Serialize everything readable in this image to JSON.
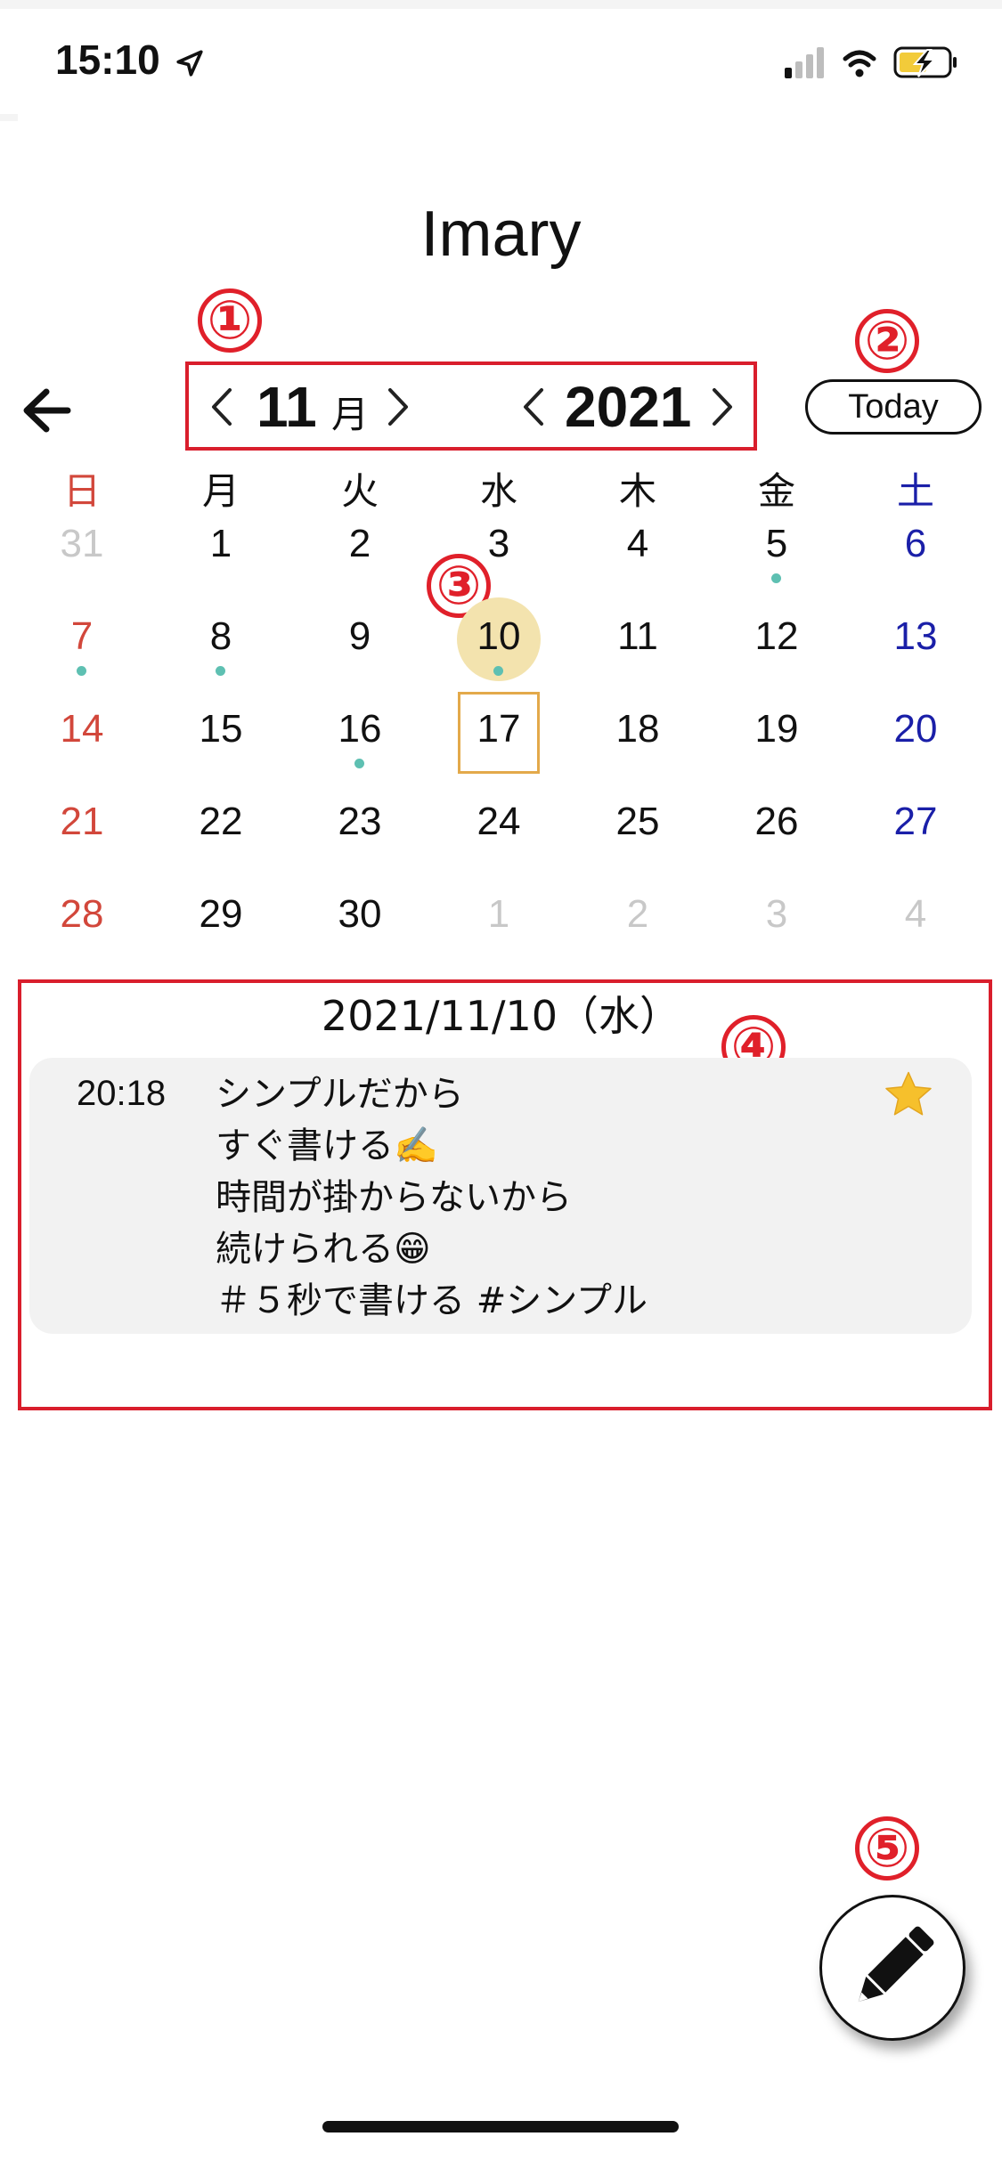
{
  "status_bar": {
    "time": "15:10"
  },
  "app": {
    "title": "Imary"
  },
  "annotations": [
    "①",
    "②",
    "③",
    "④",
    "⑤"
  ],
  "header": {
    "month": "11",
    "month_unit": "月",
    "year": "2021",
    "today_label": "Today"
  },
  "calendar": {
    "weekdays": [
      "日",
      "月",
      "火",
      "水",
      "木",
      "金",
      "土"
    ],
    "weeks": [
      [
        "31",
        "1",
        "2",
        "3",
        "4",
        "5",
        "6"
      ],
      [
        "7",
        "8",
        "9",
        "10",
        "11",
        "12",
        "13"
      ],
      [
        "14",
        "15",
        "16",
        "17",
        "18",
        "19",
        "20"
      ],
      [
        "21",
        "22",
        "23",
        "24",
        "25",
        "26",
        "27"
      ],
      [
        "28",
        "29",
        "30",
        "1",
        "2",
        "3",
        "4"
      ]
    ],
    "selected_date": "10",
    "today_date": "17"
  },
  "entry": {
    "date_label": "2021/11/10（水）",
    "time": "20:18",
    "lines": [
      "シンプルだから",
      "すぐ書ける✍️",
      "時間が掛からないから",
      "続けられる😁",
      "＃５秒で書ける #シンプル"
    ],
    "starred": true
  },
  "colors": {
    "sunday": "#d2473b",
    "saturday": "#1a1fa8",
    "faded": "#c8c8c8",
    "event_dot": "#5ec0b2",
    "selected": "#f3e3ae",
    "today_outline": "#e3a94a",
    "annotation": "#e0202a"
  },
  "icons": [
    "location-arrow-icon",
    "signal-icon",
    "wifi-icon",
    "battery-charging-icon",
    "back-arrow-icon",
    "chevron-left-icon",
    "chevron-right-icon",
    "star-icon",
    "pencil-icon"
  ]
}
